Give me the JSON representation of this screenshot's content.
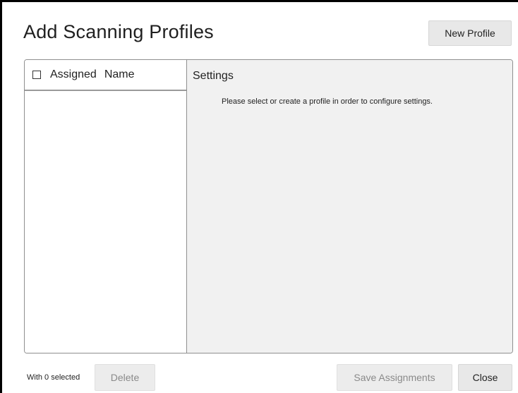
{
  "dialog": {
    "title": "Add Scanning Profiles",
    "new_profile_label": "New Profile"
  },
  "list": {
    "columns": [
      "Assigned",
      "Name"
    ],
    "items": []
  },
  "settings": {
    "title": "Settings",
    "message": "Please select or create a profile in order to configure settings."
  },
  "footer": {
    "selection_status": "With 0 selected",
    "delete_label": "Delete",
    "save_label": "Save Assignments",
    "close_label": "Close"
  }
}
